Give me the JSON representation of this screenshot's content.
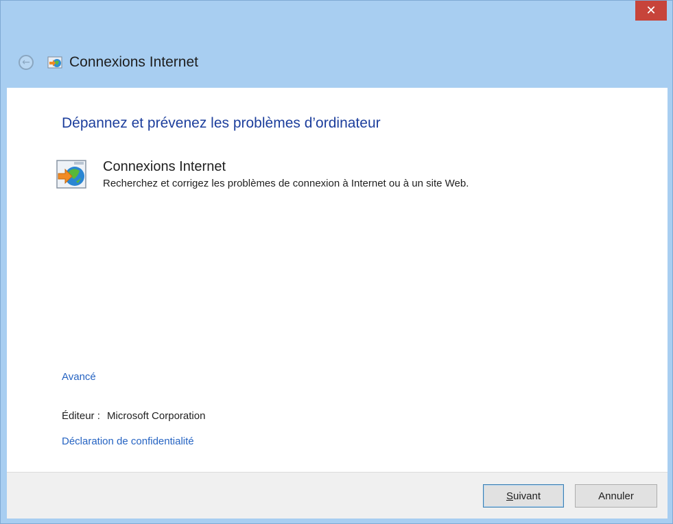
{
  "window": {
    "title": "Connexions Internet",
    "close_glyph": "✕"
  },
  "main": {
    "heading": "Dépannez et prévenez les problèmes d’ordinateur",
    "task": {
      "title": "Connexions Internet",
      "description": "Recherchez et corrigez les problèmes de connexion à Internet ou à un site Web."
    },
    "advanced_link": "Avancé",
    "publisher_label": "Éditeur :",
    "publisher_value": "Microsoft Corporation",
    "privacy_link": "Déclaration de confidentialité"
  },
  "footer": {
    "next_label_underlined": "S",
    "next_label_rest": "uivant",
    "cancel_label": "Annuler"
  },
  "icons": {
    "back": "back-arrow-icon",
    "app": "internet-connections-icon",
    "close": "close-icon"
  },
  "colors": {
    "titlebar": "#a8cef1",
    "close": "#c7443a",
    "heading": "#1c3e9c",
    "link": "#2563c2"
  }
}
